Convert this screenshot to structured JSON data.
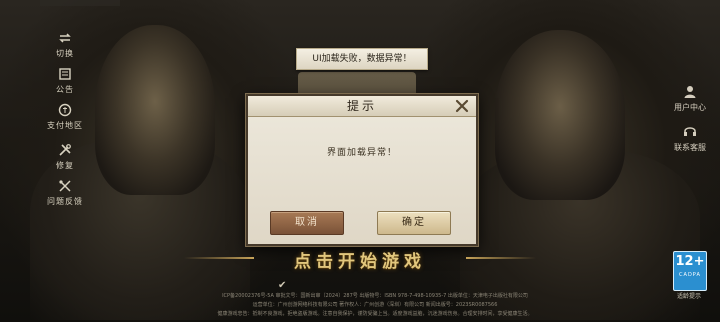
{
  "side_menu": [
    {
      "label": "切换",
      "icon": "switch-account-icon"
    },
    {
      "label": "公告",
      "icon": "announcement-icon"
    },
    {
      "label": "支付地区",
      "icon": "payment-region-icon"
    },
    {
      "label": "修复",
      "icon": "repair-tools-icon"
    },
    {
      "label": "问题反馈",
      "icon": "feedback-icon"
    }
  ],
  "right_menu": [
    {
      "label": "用户中心",
      "icon": "user-center-icon"
    },
    {
      "label": "联系客服",
      "icon": "customer-service-icon"
    }
  ],
  "toast": {
    "text": "UI加载失败，数据异常！"
  },
  "dialog": {
    "title": "提示",
    "message": "界面加载异常！",
    "cancel_label": "取消",
    "confirm_label": "确定"
  },
  "start_text": "点击开始游戏",
  "legal_lines": [
    "ICP备20002376号-5A 审批文号：国新出审〔2024〕287号 出版物号：ISBN 978-7-498-10935-7 出版单位：天津电子出版社有限公司",
    "运营单位：广州创游网络科技有限公司 著作权人：广州创游（深圳）有限公司 新闻出版号：2023SR0087566",
    "健康游戏忠告：抵制不良游戏，拒绝盗版游戏。注意自我保护，谨防受骗上当。适度游戏益脑，沉迷游戏伤身。合理安排时间，享受健康生活。"
  ],
  "age_rating": {
    "number": "12+",
    "org": "CADPA",
    "label": "适龄提示"
  },
  "colors": {
    "accent_gold": "#e2c77d",
    "dialog_bg": "#e6e0d2",
    "cancel_btn": "#8f6444",
    "confirm_btn": "#ddcba2",
    "age_badge": "#2b8fd0"
  }
}
